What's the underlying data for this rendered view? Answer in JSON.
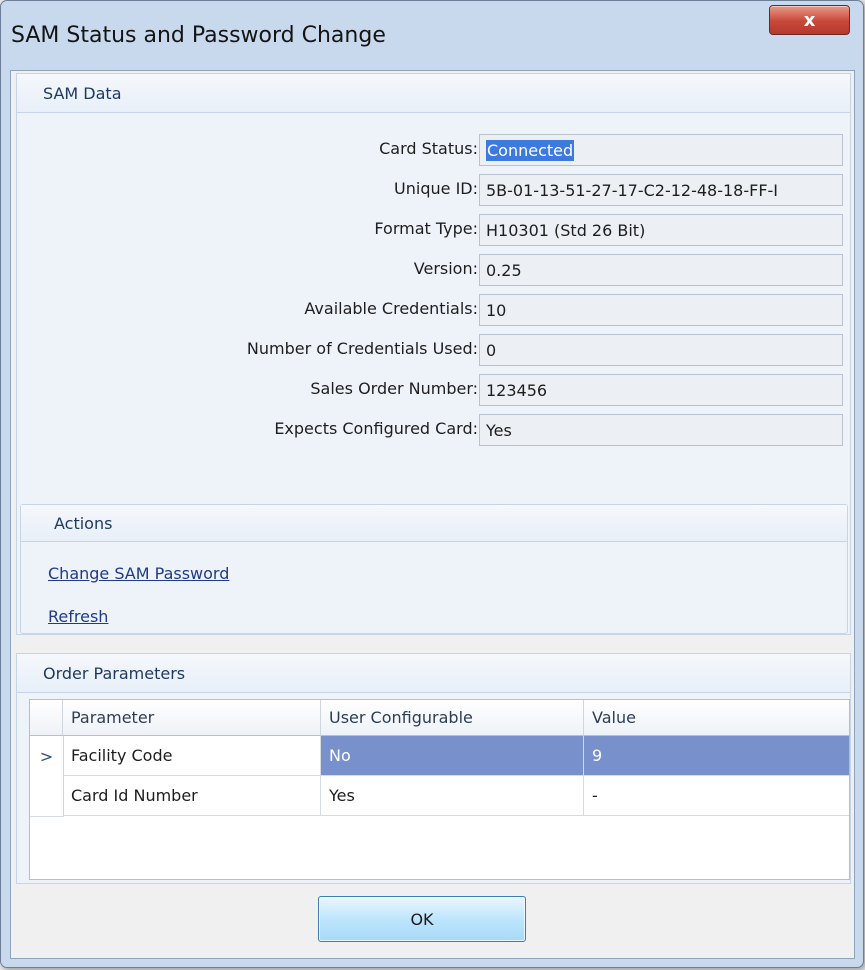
{
  "window": {
    "title": "SAM Status and Password Change",
    "close_glyph": "x"
  },
  "sam_data": {
    "header": "SAM Data",
    "fields": [
      {
        "label": "Card Status:",
        "value": "Connected"
      },
      {
        "label": "Unique ID:",
        "value": "5B-01-13-51-27-17-C2-12-48-18-FF-I"
      },
      {
        "label": "Format Type:",
        "value": "H10301 (Std 26 Bit)"
      },
      {
        "label": "Version:",
        "value": "0.25"
      },
      {
        "label": "Available Credentials:",
        "value": "10"
      },
      {
        "label": "Number of Credentials Used:",
        "value": "0"
      },
      {
        "label": "Sales Order Number:",
        "value": "123456"
      },
      {
        "label": "Expects Configured Card:",
        "value": "Yes"
      }
    ]
  },
  "actions": {
    "header": "Actions",
    "change_password": "Change SAM Password",
    "refresh": "Refresh"
  },
  "order_parameters": {
    "header": "Order Parameters",
    "columns": [
      "Parameter",
      "User Configurable",
      "Value"
    ],
    "rows": [
      {
        "parameter": "Facility Code",
        "user_configurable": "No",
        "value": "9",
        "selected": true
      },
      {
        "parameter": "Card Id Number",
        "user_configurable": "Yes",
        "value": "-",
        "selected": false
      }
    ],
    "current_row_glyph": ">"
  },
  "buttons": {
    "ok": "OK"
  },
  "colors": {
    "selection": "#3d7ae0",
    "grid_selection": "#7891cc",
    "close_button": "#c9473a",
    "link": "#1f3a8a"
  }
}
